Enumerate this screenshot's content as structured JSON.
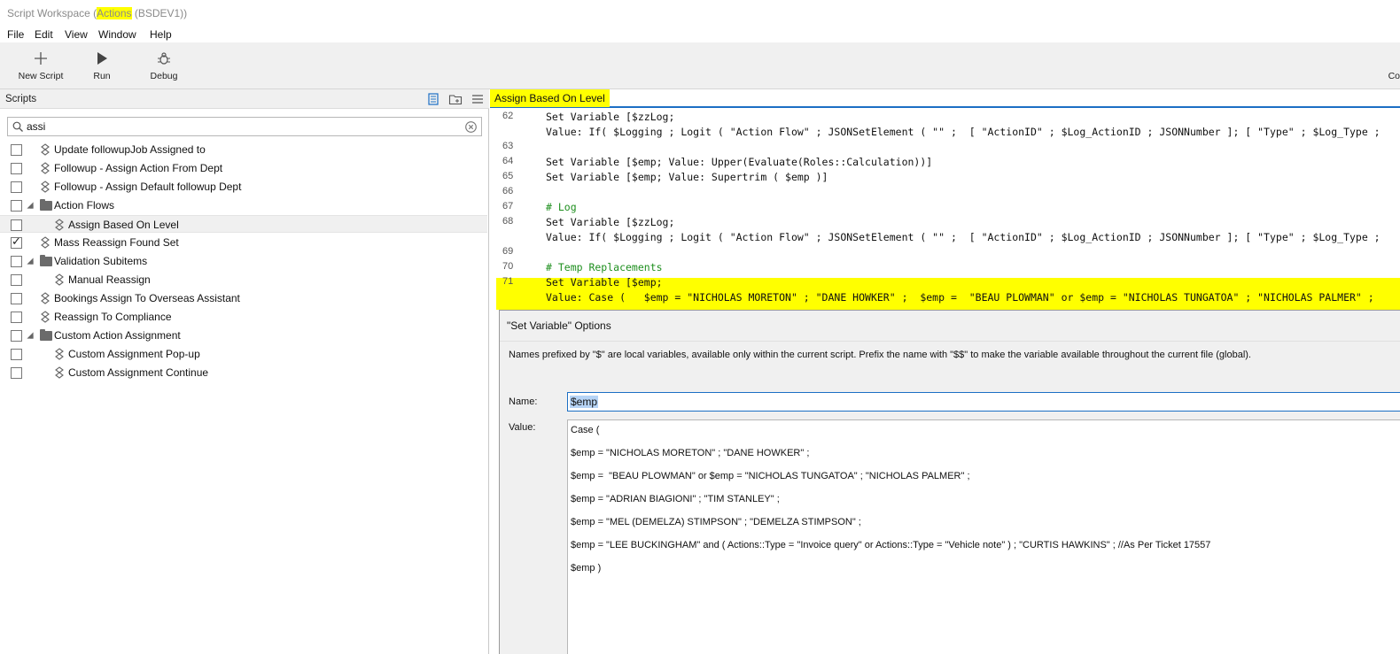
{
  "window": {
    "title_prefix": "Script Workspace (",
    "title_file": "Actions",
    "title_suffix": " (BSDEV1))"
  },
  "menu": [
    "File",
    "Edit",
    "View",
    "Window",
    "Help"
  ],
  "toolbar": {
    "new_script": "New Script",
    "run": "Run",
    "debug": "Debug",
    "cut_label": "Co"
  },
  "scripts_panel": {
    "header": "Scripts",
    "search_value": "assi",
    "items": [
      {
        "label": "Update followupJob Assigned to",
        "type": "script",
        "checked": false,
        "indent": 0
      },
      {
        "label": "Followup - Assign Action From Dept",
        "type": "script",
        "checked": false,
        "indent": 0
      },
      {
        "label": "Followup - Assign Default followup Dept",
        "type": "script",
        "checked": false,
        "indent": 0
      },
      {
        "label": "Action Flows",
        "type": "folder",
        "checked": false,
        "indent": 0
      },
      {
        "label": "Assign Based On Level",
        "type": "script",
        "checked": false,
        "indent": 1
      },
      {
        "label": "Mass Reassign Found Set",
        "type": "script",
        "checked": true,
        "indent": 0
      },
      {
        "label": "Validation Subitems",
        "type": "folder",
        "checked": false,
        "indent": 0
      },
      {
        "label": "Manual Reassign",
        "type": "script",
        "checked": false,
        "indent": 1
      },
      {
        "label": "Bookings Assign To Overseas Assistant",
        "type": "script",
        "checked": false,
        "indent": 0
      },
      {
        "label": "Reassign To Compliance",
        "type": "script",
        "checked": false,
        "indent": 0
      },
      {
        "label": "Custom Action Assignment",
        "type": "folder",
        "checked": false,
        "indent": 0
      },
      {
        "label": "Custom Assignment Pop-up",
        "type": "script",
        "checked": false,
        "indent": 1
      },
      {
        "label": "Custom Assignment Continue",
        "type": "script",
        "checked": false,
        "indent": 1
      }
    ]
  },
  "editor": {
    "tab": "Assign Based On Level",
    "lines": [
      {
        "n": "62",
        "text": "Set Variable [$zzLog;",
        "cls": ""
      },
      {
        "n": "",
        "text": "Value: If( $Logging ; Logit ( \"Action Flow\" ; JSONSetElement ( \"\" ;  [ \"ActionID\" ; $Log_ActionID ; JSONNumber ]; [ \"Type\" ; $Log_Type ;",
        "cls": ""
      },
      {
        "n": "63",
        "text": "",
        "cls": ""
      },
      {
        "n": "64",
        "text": "Set Variable [$emp; Value: Upper(Evaluate(Roles::Calculation))]",
        "cls": ""
      },
      {
        "n": "65",
        "text": "Set Variable [$emp; Value: Supertrim ( $emp )]",
        "cls": ""
      },
      {
        "n": "66",
        "text": "",
        "cls": ""
      },
      {
        "n": "67",
        "text": "# Log",
        "cls": "cmt"
      },
      {
        "n": "68",
        "text": "Set Variable [$zzLog;",
        "cls": ""
      },
      {
        "n": "",
        "text": "Value: If( $Logging ; Logit ( \"Action Flow\" ; JSONSetElement ( \"\" ;  [ \"ActionID\" ; $Log_ActionID ; JSONNumber ]; [ \"Type\" ; $Log_Type ;",
        "cls": ""
      },
      {
        "n": "69",
        "text": "",
        "cls": ""
      },
      {
        "n": "70",
        "text": "# Temp Replacements",
        "cls": "cmt"
      },
      {
        "n": "71",
        "text": "Set Variable [$emp;",
        "cls": ""
      },
      {
        "n": "",
        "text": "Value: Case (   $emp = \"NICHOLAS MORETON\" ; \"DANE HOWKER\" ;  $emp =  \"BEAU PLOWMAN\" or $emp = \"NICHOLAS TUNGATOA\" ; \"NICHOLAS PALMER\" ;",
        "cls": ""
      }
    ]
  },
  "dialog": {
    "title": "\"Set Variable\" Options",
    "description": "Names prefixed by \"$\" are local variables, available only within the current script. Prefix the name with \"$$\" to make the variable available throughout the current file (global).",
    "name_label": "Name:",
    "name_value": "$emp",
    "value_label": "Value:",
    "value_lines": [
      "Case (",
      "$emp = \"NICHOLAS MORETON\" ; \"DANE HOWKER\" ;",
      "$emp =  \"BEAU PLOWMAN\" or $emp = \"NICHOLAS TUNGATOA\" ; \"NICHOLAS PALMER\" ;",
      "$emp = \"ADRIAN BIAGIONI\" ; \"TIM STANLEY\" ;",
      "$emp = \"MEL (DEMELZA) STIMPSON\" ; \"DEMELZA STIMPSON\" ;",
      "$emp = \"LEE BUCKINGHAM\" and ( Actions::Type = \"Invoice query\" or Actions::Type = \"Vehicle note\" ) ; \"CURTIS HAWKINS\" ; //As Per Ticket 17557",
      "$emp )"
    ]
  },
  "colors": {
    "highlight": "#ffff00",
    "accent": "#1c6fc4",
    "comment": "#1e8f1e"
  }
}
